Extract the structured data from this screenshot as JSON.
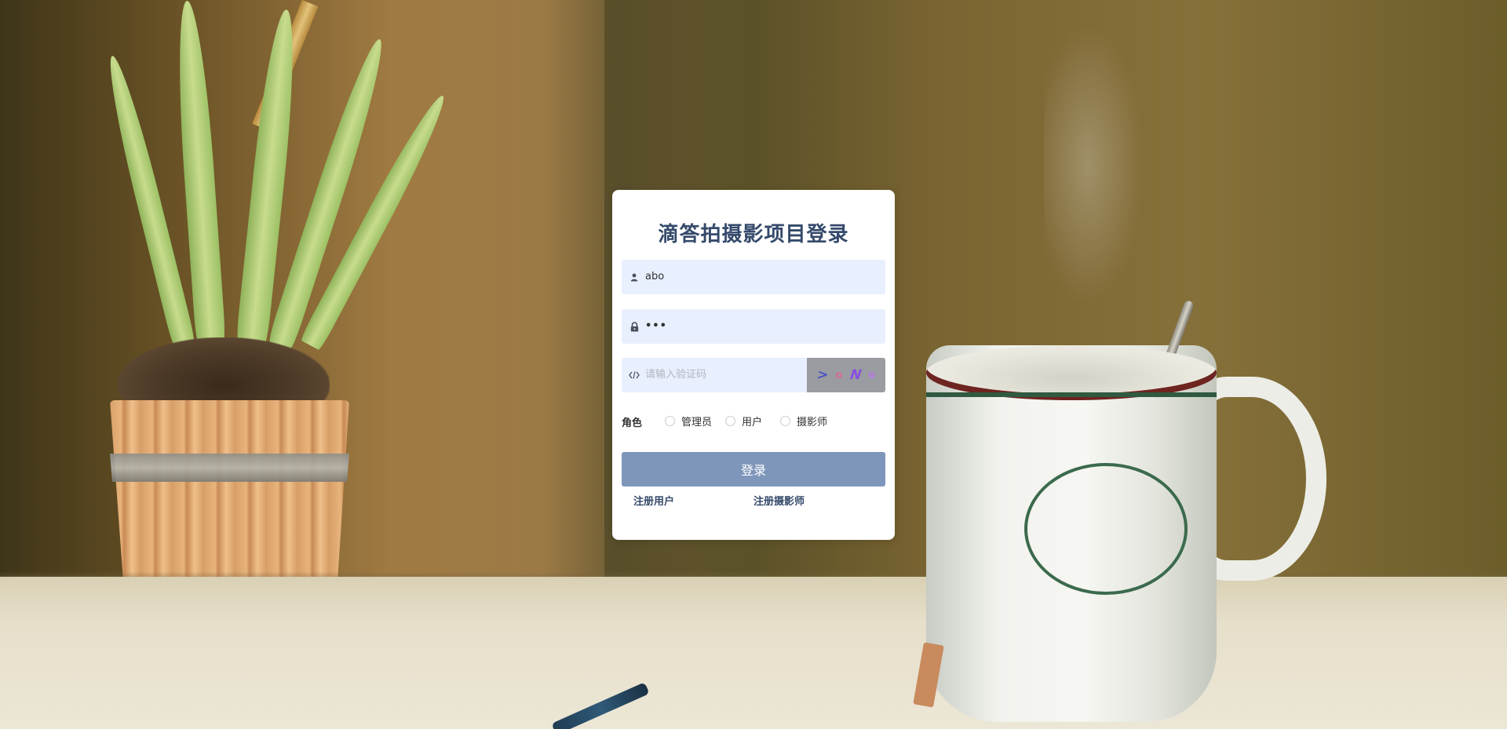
{
  "login": {
    "title": "滴答拍摄影项目登录",
    "username": {
      "value": "abo",
      "icon": "user-icon"
    },
    "password": {
      "value": "•••",
      "icon": "lock-icon"
    },
    "captcha": {
      "placeholder": "请输入验证码",
      "icon": "code-icon",
      "chars": [
        {
          "char": ">",
          "color": "#4b4ec8"
        },
        {
          "char": "o",
          "color": "#d86a9a"
        },
        {
          "char": "N",
          "color": "#8a4fe0"
        },
        {
          "char": "o",
          "color": "#b778e8"
        }
      ]
    },
    "role": {
      "label": "角色",
      "options": [
        "管理员",
        "用户",
        "摄影师"
      ]
    },
    "submit_label": "登录",
    "links": {
      "register_user": "注册用户",
      "register_photographer": "注册摄影师"
    }
  },
  "colors": {
    "title": "#354a6b",
    "input_bg": "#e8effe",
    "button_bg": "#7f96bb",
    "captcha_bg": "#9a9ca1"
  }
}
